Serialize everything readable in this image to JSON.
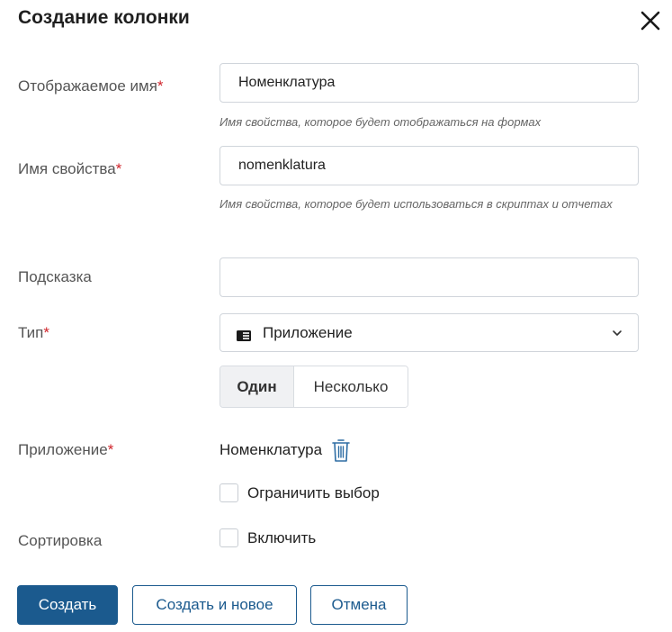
{
  "dialog": {
    "title": "Создание колонки",
    "close_icon": "close-icon"
  },
  "fields": {
    "display_name": {
      "label": "Отображаемое имя",
      "required_mark": "*",
      "value": "Номенклатура",
      "hint": "Имя свойства, которое будет отображаться на формах"
    },
    "property_name": {
      "label": "Имя свойства",
      "required_mark": "*",
      "value": "nomenklatura",
      "hint": "Имя свойства, которое будет использоваться в скриптах и отчетах"
    },
    "tooltip": {
      "label": "Подсказка",
      "value": ""
    },
    "type": {
      "label": "Тип",
      "required_mark": "*",
      "selected": "Приложение",
      "icon": "application-icon"
    },
    "multiplicity": {
      "options": [
        "Один",
        "Несколько"
      ],
      "selected": "Один"
    },
    "application": {
      "label": "Приложение",
      "required_mark": "*",
      "value": "Номенклатура",
      "delete_icon": "trash-icon",
      "restrict_label": "Ограничить выбор",
      "restrict_checked": false
    },
    "sorting": {
      "label": "Сортировка",
      "enable_label": "Включить",
      "enable_checked": false
    }
  },
  "buttons": {
    "create": "Создать",
    "create_and_new": "Создать и новое",
    "cancel": "Отмена"
  },
  "colors": {
    "primary": "#1b5a8e",
    "required": "#d0242b",
    "icon_blue": "#2e6da4"
  }
}
